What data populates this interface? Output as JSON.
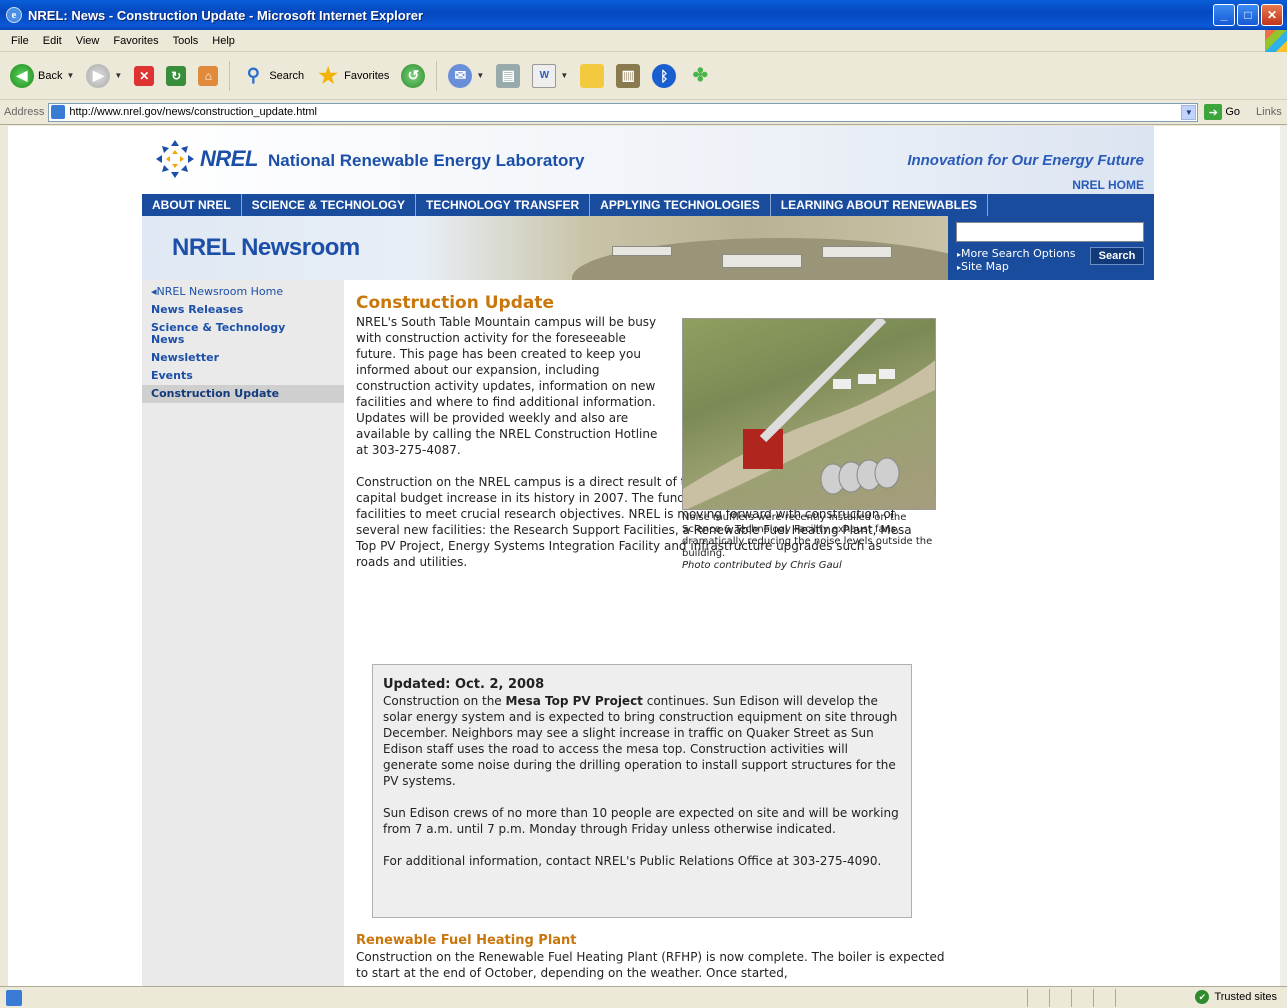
{
  "window": {
    "title": "NREL: News - Construction Update - Microsoft Internet Explorer"
  },
  "menu": [
    "File",
    "Edit",
    "View",
    "Favorites",
    "Tools",
    "Help"
  ],
  "toolbar": {
    "back_label": "Back",
    "search_label": "Search",
    "favorites_label": "Favorites"
  },
  "address": {
    "label": "Address",
    "url": "http://www.nrel.gov/news/construction_update.html",
    "go_label": "Go",
    "links_label": "Links"
  },
  "status": {
    "zone": "Trusted sites"
  },
  "site": {
    "logo": "NREL",
    "lab_name": "National Renewable Energy Laboratory",
    "tagline": "Innovation for Our Energy Future",
    "home_link": "NREL HOME",
    "nav": [
      "ABOUT NREL",
      "SCIENCE & TECHNOLOGY",
      "TECHNOLOGY TRANSFER",
      "APPLYING TECHNOLOGIES",
      "LEARNING ABOUT RENEWABLES"
    ],
    "banner_title": "NREL Newsroom",
    "search": {
      "more_options": "More Search Options",
      "site_map": "Site Map",
      "button": "Search"
    },
    "sidebar": [
      {
        "label": "NREL Newsroom Home"
      },
      {
        "label": "News Releases"
      },
      {
        "label": "Science & Technology News"
      },
      {
        "label": "Newsletter"
      },
      {
        "label": "Events"
      },
      {
        "label": "Construction Update"
      }
    ]
  },
  "article": {
    "title": "Construction Update",
    "para1": "NREL's South Table Mountain campus will be busy with construction activity for the foreseeable future. This page has been created to keep you informed about our expansion, including construction activity updates, information on new facilities and where to find additional information. Updates will be provided weekly and also are available by calling the NREL Construction Hotline at 303-275-4087.",
    "para2": "Construction on the NREL campus is a direct result of the Laboratory receiving the largest capital budget increase in its history in 2007. The funds are designated for building key facilities to meet crucial research objectives. NREL is moving forward with construction of several new facilities: the Research Support Facilities, a Renewable Fuel Heating Plant, Mesa Top PV Project, Energy Systems Integration Facility and infrastructure upgrades such as roads and utilities.",
    "photo_caption": "Noise mufflers were recently installed on the Science & Technology Facility exhaust fans, dramatically reducing the noise levels outside the building.",
    "photo_credit": "Photo contributed by Chris Gaul",
    "update": {
      "date": "Updated: Oct. 2, 2008",
      "p1_before": "Construction on the ",
      "p1_bold": "Mesa Top PV Project",
      "p1_after": " continues. Sun Edison will develop the solar energy system and is expected to bring construction equipment on site through December. Neighbors may see a slight increase in traffic on Quaker Street as Sun Edison staff uses the road to access the mesa top. Construction activities will generate some noise during the drilling operation to install support structures for the PV systems.",
      "p2": "Sun Edison crews of no more than 10 people are expected on site and will be working from 7 a.m. until 7 p.m. Monday through Friday unless otherwise indicated.",
      "p3": "For additional information, contact NREL's Public Relations Office at 303-275-4090."
    },
    "section2_title": "Renewable Fuel Heating Plant",
    "section2_text": "Construction on the Renewable Fuel Heating Plant (RFHP) is now complete. The boiler is expected to start at the end of October, depending on the weather. Once started,"
  }
}
